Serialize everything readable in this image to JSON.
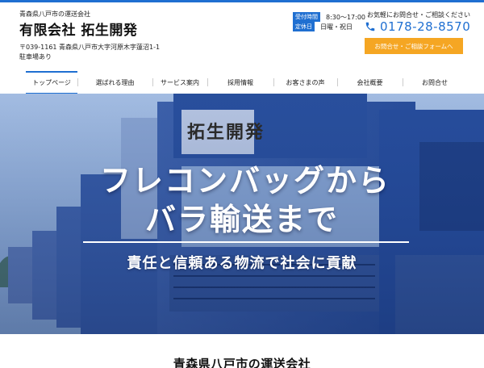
{
  "header": {
    "tagline": "青森県八戸市の運送会社",
    "company": "有限会社 拓生開発",
    "address": "〒039-1161 青森県八戸市大字河原木字蓮沼1-1",
    "parking": "駐車場あり",
    "hours_label": "受付時間",
    "hours_value": "8:30〜17:00",
    "closed_label": "定休日",
    "closed_value": "日曜・祝日",
    "contact_label": "お気軽にお問合せ・ご相談ください",
    "phone": "0178-28-8570",
    "form_button": "お問合せ・ご相談フォームへ"
  },
  "nav": {
    "items": [
      "トップページ",
      "選ばれる理由",
      "サービス案内",
      "採用情報",
      "お客さまの声",
      "会社概要",
      "お問合せ"
    ],
    "active_index": 0
  },
  "hero": {
    "line1": "フレコンバッグから",
    "line2": "バラ輸送まで",
    "subtitle": "責任と信頼ある物流で社会に貢献",
    "truck_lettering": "拓生開発"
  },
  "section": {
    "title": "青森県八戸市の運送会社"
  },
  "colors": {
    "accent": "#1f6fd1",
    "button": "#f5a623",
    "hero_tint": "#1b3d83"
  },
  "icons": {
    "phone": "phone-icon"
  }
}
